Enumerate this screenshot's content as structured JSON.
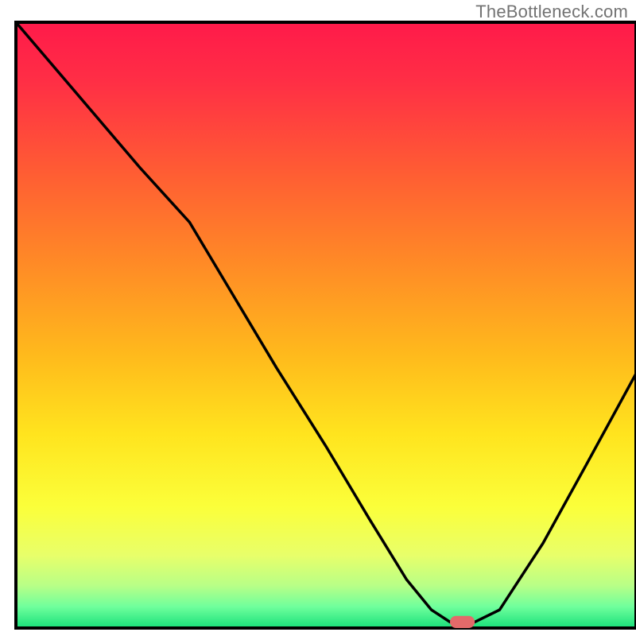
{
  "watermark": "TheBottleneck.com",
  "chart_data": {
    "type": "line",
    "title": "",
    "xlabel": "",
    "ylabel": "",
    "xlim": [
      0,
      100
    ],
    "ylim": [
      0,
      100
    ],
    "grid": false,
    "legend": false,
    "axes_visible": false,
    "background_gradient": {
      "stops": [
        {
          "offset": 0.0,
          "color": "#ff1a4a"
        },
        {
          "offset": 0.1,
          "color": "#ff2f45"
        },
        {
          "offset": 0.25,
          "color": "#ff5d33"
        },
        {
          "offset": 0.4,
          "color": "#ff8b26"
        },
        {
          "offset": 0.55,
          "color": "#ffba1c"
        },
        {
          "offset": 0.68,
          "color": "#ffe41e"
        },
        {
          "offset": 0.8,
          "color": "#fbff3a"
        },
        {
          "offset": 0.88,
          "color": "#e8ff6a"
        },
        {
          "offset": 0.93,
          "color": "#b8ff87"
        },
        {
          "offset": 0.965,
          "color": "#6fff9c"
        },
        {
          "offset": 1.0,
          "color": "#18e07a"
        }
      ]
    },
    "series": [
      {
        "name": "bottleneck-curve",
        "color": "#000000",
        "x": [
          0,
          10,
          20,
          28,
          35,
          42,
          50,
          57,
          63,
          67,
          70,
          74,
          78,
          85,
          92,
          100
        ],
        "values": [
          100,
          88,
          76,
          67,
          55,
          43,
          30,
          18,
          8,
          3,
          1,
          1,
          3,
          14,
          27,
          42
        ]
      }
    ],
    "marker": {
      "name": "optimal-point",
      "x": 72,
      "y": 1,
      "width": 4,
      "height": 2,
      "color": "#e36a6a"
    }
  }
}
